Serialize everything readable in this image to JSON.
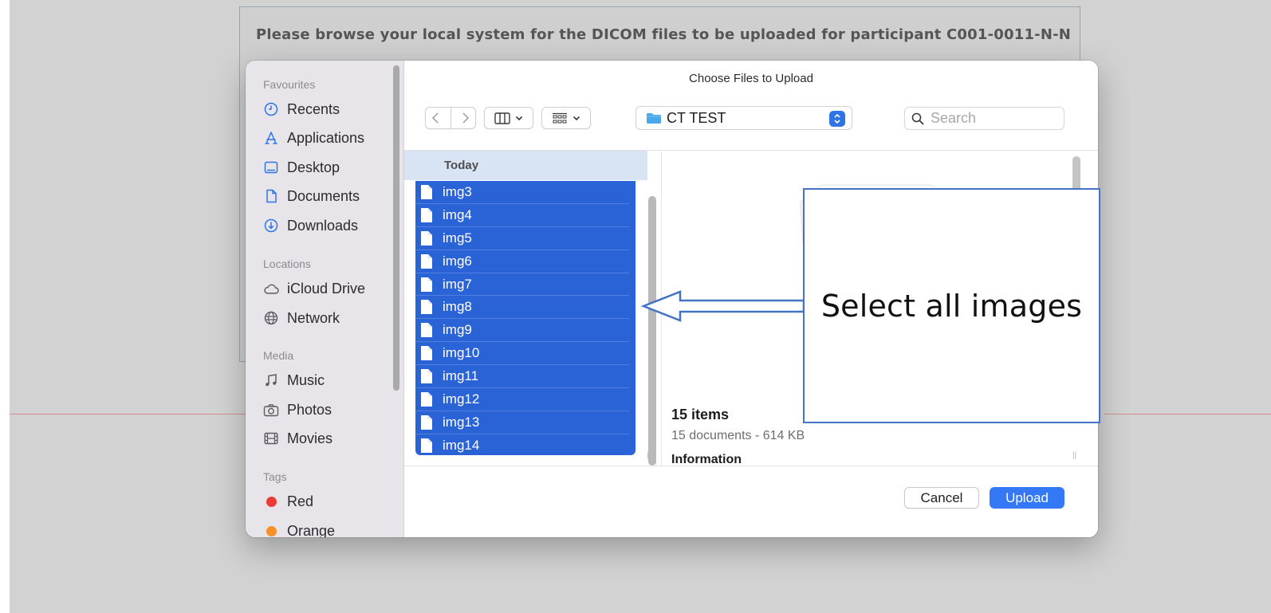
{
  "page": {
    "instruction": "Please browse your local system for the DICOM files to be uploaded for participant C001-0011-N-N"
  },
  "dialog": {
    "title": "Choose Files to Upload",
    "path": "CT TEST",
    "search_placeholder": "Search",
    "column_header": "Today",
    "files": [
      "img3",
      "img4",
      "img5",
      "img6",
      "img7",
      "img8",
      "img9",
      "img10",
      "img11",
      "img12",
      "img13",
      "img14"
    ],
    "summary": {
      "count": "15 items",
      "detail": "15 documents - 614 KB",
      "info_label": "Information"
    },
    "buttons": {
      "cancel": "Cancel",
      "upload": "Upload"
    }
  },
  "sidebar": {
    "favourites_heading": "Favourites",
    "favourites": [
      {
        "label": "Recents",
        "icon": "clock-icon"
      },
      {
        "label": "Applications",
        "icon": "applications-icon"
      },
      {
        "label": "Desktop",
        "icon": "desktop-icon"
      },
      {
        "label": "Documents",
        "icon": "document-icon"
      },
      {
        "label": "Downloads",
        "icon": "download-icon"
      }
    ],
    "locations_heading": "Locations",
    "locations": [
      {
        "label": "iCloud Drive",
        "icon": "cloud-icon"
      },
      {
        "label": "Network",
        "icon": "globe-icon"
      }
    ],
    "media_heading": "Media",
    "media": [
      {
        "label": "Music",
        "icon": "music-icon"
      },
      {
        "label": "Photos",
        "icon": "camera-icon"
      },
      {
        "label": "Movies",
        "icon": "film-icon"
      }
    ],
    "tags_heading": "Tags",
    "tags": [
      {
        "label": "Red",
        "color": "#ec3b34"
      },
      {
        "label": "Orange",
        "color": "#f5902a"
      }
    ]
  },
  "annotation": {
    "callout": "Select all images",
    "border_color": "#4472c4"
  },
  "colors": {
    "selection": "#2a63d6",
    "primary_button": "#3478f6",
    "folder": "#4aa7ec"
  }
}
